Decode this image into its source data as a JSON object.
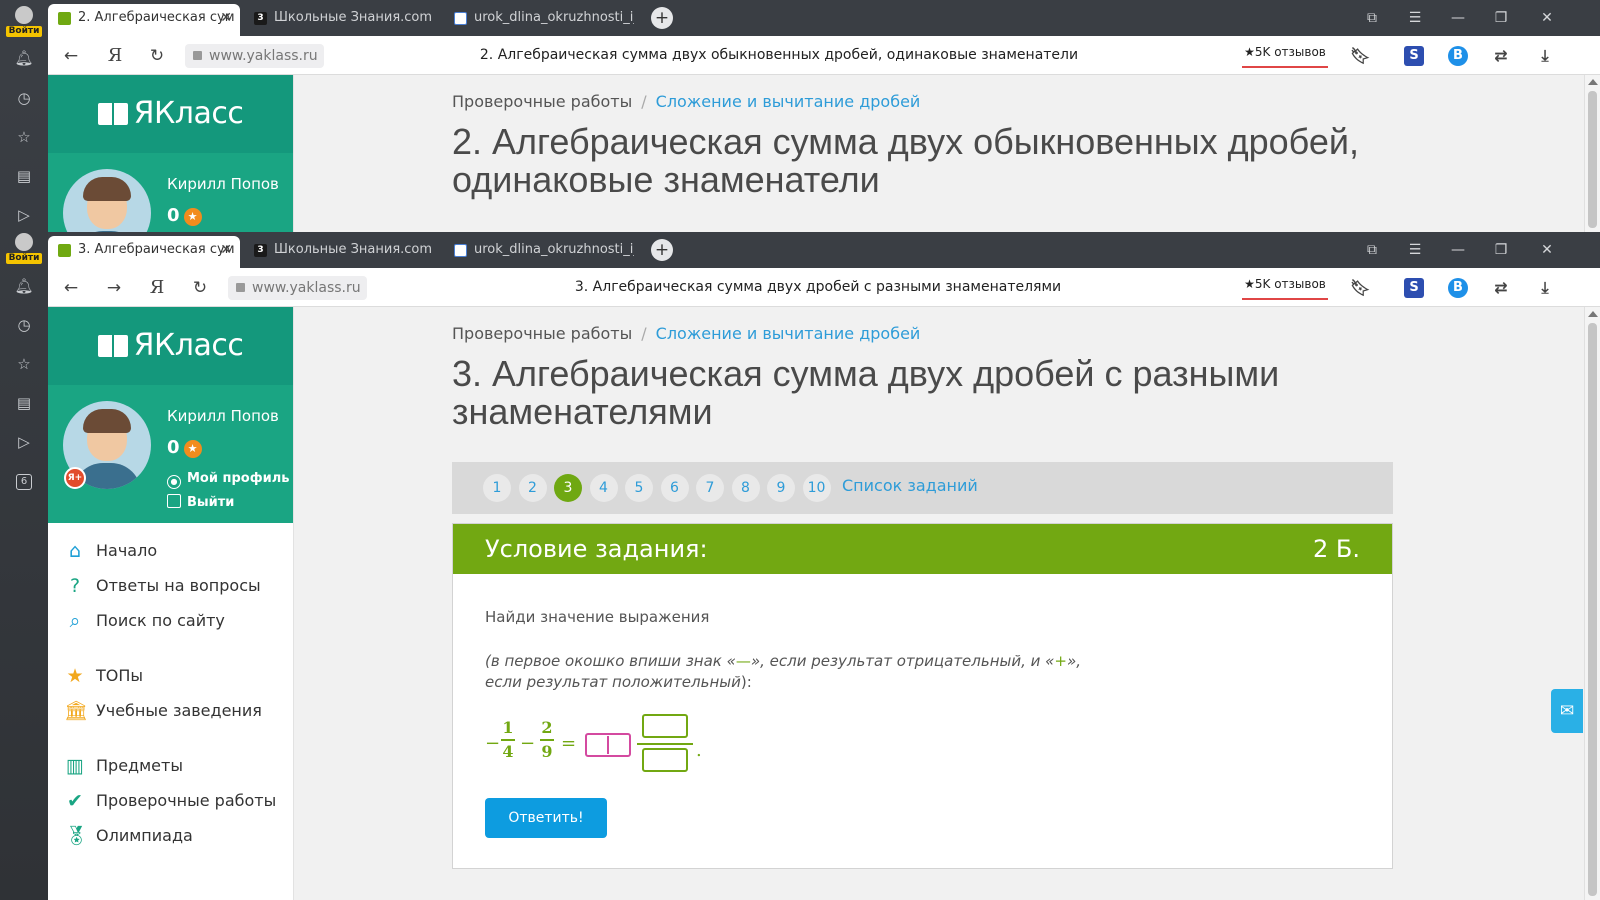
{
  "rail": {
    "login_label": "Войти"
  },
  "tabs_common": {
    "tab2": "Школьные Знания.com - I",
    "tab3": "urok_dlina_okruzhnosti_i_p",
    "tab2_icon": "3",
    "new_tab_icon": "+"
  },
  "window1": {
    "active_tab": "2. Алгебраическая сум",
    "url": "www.yaklass.ru",
    "page_title": "2. Алгебраическая сумма двух обыкновенных дробей, одинаковые знаменатели",
    "heading": "2. Алгебраическая сумма двух обыкновенных дробей, одинаковые знаменатели"
  },
  "window2": {
    "active_tab": "3. Алгебраическая сум",
    "url": "www.yaklass.ru",
    "page_title": "3. Алгебраическая сумма двух дробей с разными знаменателями",
    "heading": "3. Алгебраическая сумма двух дробей с разными знаменателями"
  },
  "browser": {
    "reviews": "★5K отзывов",
    "ext_s": "S",
    "ext_b": "B"
  },
  "site": {
    "logo": "ЯКласс",
    "user_name": "Кирилл Попов",
    "points": "0",
    "my_profile": "Мой профиль",
    "logout": "Выйти",
    "badge": "Я+"
  },
  "menu": [
    {
      "label": "Начало",
      "icon": "home-icon",
      "color": "#1e9fd6"
    },
    {
      "label": "Ответы на вопросы",
      "icon": "question-icon",
      "color": "#1aa583"
    },
    {
      "label": "Поиск по сайту",
      "icon": "search-icon",
      "color": "#1e9fd6"
    },
    {
      "label": "ТОПы",
      "icon": "star-icon",
      "color": "#f2a81d"
    },
    {
      "label": "Учебные заведения",
      "icon": "school-icon",
      "color": "#f2a81d"
    },
    {
      "label": "Предметы",
      "icon": "books-icon",
      "color": "#1aa583"
    },
    {
      "label": "Проверочные работы",
      "icon": "check-icon",
      "color": "#1aa583"
    },
    {
      "label": "Олимпиада",
      "icon": "medal-icon",
      "color": "#1aa583"
    }
  ],
  "breadcrumb": {
    "root": "Проверочные работы",
    "section": "Сложение и вычитание дробей"
  },
  "pager": {
    "pages": [
      "1",
      "2",
      "3",
      "4",
      "5",
      "6",
      "7",
      "8",
      "9",
      "10"
    ],
    "current": "3",
    "task_list": "Список заданий"
  },
  "task": {
    "header": "Условие задания:",
    "points": "2 Б.",
    "text": "Найди значение выражения",
    "hint_part1": "(в первое окошко впиши знак «",
    "minus_sign": "—",
    "hint_part2": "», если результат отрицательный, и «",
    "plus_sign": "+",
    "hint_part3": "»,",
    "hint_line2": "если результат положительный",
    "hint_end": "):",
    "expr": {
      "lead_minus": "−",
      "f1_num": "1",
      "f1_den": "4",
      "op": "−",
      "f2_num": "2",
      "f2_den": "9",
      "eq": "=",
      "dot": "."
    },
    "submit": "Ответить!"
  },
  "colors": {
    "teal": "#14987c",
    "green": "#72a812",
    "blue": "#2e9cd8"
  }
}
